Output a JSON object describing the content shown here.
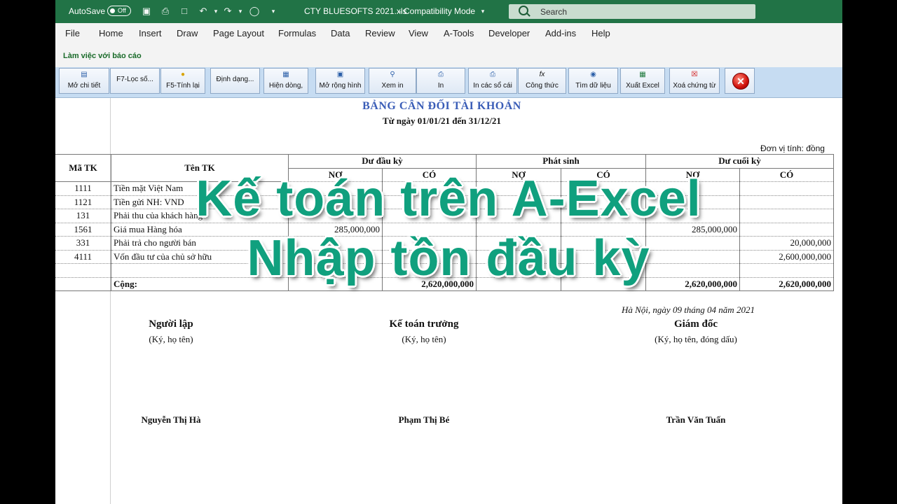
{
  "titlebar": {
    "autosave": "AutoSave",
    "autosave_state": "Off",
    "filename": "CTY BLUESOFTS 2021.xls",
    "mode": "Compatibility Mode",
    "search_placeholder": "Search"
  },
  "menu": [
    "File",
    "Home",
    "Insert",
    "Draw",
    "Page Layout",
    "Formulas",
    "Data",
    "Review",
    "View",
    "A-Tools",
    "Developer",
    "Add-ins",
    "Help"
  ],
  "ribbon_label": "Làm việc với báo cáo",
  "toolbar": {
    "buttons": [
      "Mở chi tiết",
      "F7-Lọc số...",
      "F5-Tính lại",
      "Định dạng...",
      "Hiện dòng,",
      "Mở rộng hình",
      "Xem in",
      "In",
      "In các sổ cái",
      "Công thức",
      "Tìm dữ liệu",
      "Xuất Excel",
      "Xoá chứng từ"
    ]
  },
  "report": {
    "title": "BẢNG CÂN ĐỐI TÀI KHOẢN",
    "subtitle": "Từ ngày 01/01/21 đến 31/12/21",
    "unit": "Đơn vị tính: đồng",
    "headers": {
      "code": "Mã TK",
      "name": "Tên TK",
      "opening": "Dư đầu kỳ",
      "movement": "Phát sinh",
      "closing": "Dư cuối kỳ",
      "debit": "NỢ",
      "credit": "CÓ"
    },
    "rows": [
      {
        "code": "1111",
        "name": "Tiền mặt Việt Nam",
        "od": "",
        "oc": "",
        "md": "",
        "mc": "",
        "cd": "",
        "cc": ""
      },
      {
        "code": "1121",
        "name": "Tiền gửi NH: VND",
        "od": "",
        "oc": "",
        "md": "",
        "mc": "",
        "cd": "",
        "cc": ""
      },
      {
        "code": "131",
        "name": "Phải thu của khách hàng",
        "od": "",
        "oc": "",
        "md": "",
        "mc": "",
        "cd": "",
        "cc": ""
      },
      {
        "code": "1561",
        "name": "Giá mua Hàng hóa",
        "od": "285,000,000",
        "oc": "",
        "md": "",
        "mc": "",
        "cd": "285,000,000",
        "cc": ""
      },
      {
        "code": "331",
        "name": "Phải trả cho người bán",
        "od": "",
        "oc": "",
        "md": "",
        "mc": "",
        "cd": "",
        "cc": "20,000,000"
      },
      {
        "code": "4111",
        "name": "Vốn đầu tư của chủ sở hữu",
        "od": "",
        "oc": "",
        "md": "",
        "mc": "",
        "cd": "",
        "cc": "2,600,000,000"
      }
    ],
    "total": {
      "label": "Cộng:",
      "od": "",
      "oc": "2,620,000,000",
      "cd": "2,620,000,000",
      "cc": "2,620,000,000"
    },
    "date": "Hà Nội, ngày 09 tháng 04 năm 2021",
    "signers": [
      {
        "title": "Người lập",
        "note": "(Ký, họ tên)",
        "name": "Nguyễn Thị Hà"
      },
      {
        "title": "Kế toán trưởng",
        "note": "(Ký, họ tên)",
        "name": "Phạm Thị Bé"
      },
      {
        "title": "Giám đốc",
        "note": "(Ký, họ tên, đóng dấu)",
        "name": "Trần Văn Tuấn"
      }
    ]
  },
  "overlay": {
    "line1": "Kế toán trên A-Excel",
    "line2": "Nhập tồn đầu kỳ"
  },
  "colors": {
    "titlebar": "#217346",
    "toolbar": "#c6dcf2",
    "report_title": "#3a5db7",
    "overlay_text": "#10a07e"
  }
}
